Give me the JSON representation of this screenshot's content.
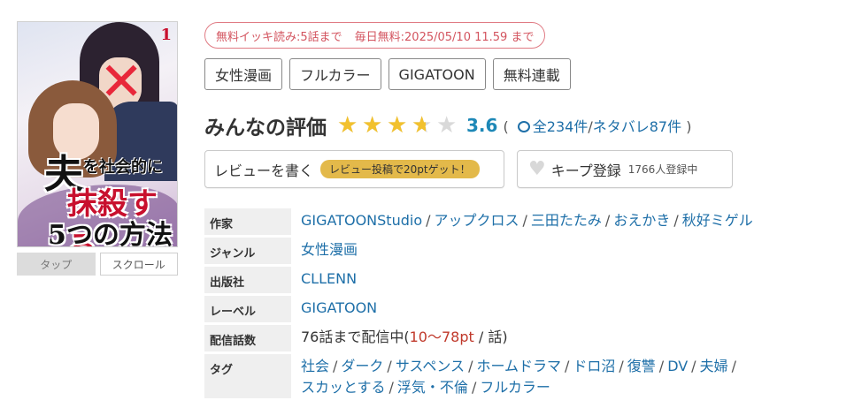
{
  "cover": {
    "volume": "1",
    "title_lines": [
      "夫",
      "を社会的に",
      "抹殺する",
      "5つの方法"
    ],
    "view_modes": [
      "タップ",
      "スクロール"
    ]
  },
  "free_info": {
    "binge": "無料イッキ読み:5話まで",
    "daily": "毎日無料:2025/05/10 11.59 まで"
  },
  "genre_chips": [
    "女性漫画",
    "フルカラー",
    "GIGATOON",
    "無料連載"
  ],
  "rating": {
    "label": "みんなの評価",
    "score": "3.6",
    "stars_value": 3.6,
    "stars_max": 5,
    "open_paren": "(",
    "total": "全234件",
    "slash": "/",
    "spoilers": "ネタバレ87件",
    "close_paren": ")"
  },
  "actions": {
    "review_label": "レビューを書く",
    "review_promo": "レビュー投稿で20ptゲット！",
    "keep_label": "キープ登録",
    "keep_count": "1766人登録中"
  },
  "info": {
    "author_key": "作家",
    "authors": [
      "GIGATOONStudio",
      "アップクロス",
      "三田たたみ",
      "おえかき",
      "秋好ミゲル"
    ],
    "genre_key": "ジャンル",
    "genre": "女性漫画",
    "publisher_key": "出版社",
    "publisher": "CLLENN",
    "label_key": "レーベル",
    "label": "GIGATOON",
    "episodes_key": "配信話数",
    "episodes_prefix": "76話まで配信中(",
    "episodes_price": "10〜78pt",
    "episodes_suffix": " / 話)",
    "tags_key": "タグ",
    "tags": [
      "社会",
      "ダーク",
      "サスペンス",
      "ホームドラマ",
      "ドロ沼",
      "復讐",
      "DV",
      "夫婦",
      "スカッとする",
      "浮気・不倫",
      "フルカラー"
    ]
  },
  "colors": {
    "link": "#1e6fa8",
    "score": "#1e88b7",
    "star": "#f2c12e",
    "free_pill": "#d3545f",
    "promo_bg": "#e3b94a",
    "price_accent": "#c0392b"
  }
}
